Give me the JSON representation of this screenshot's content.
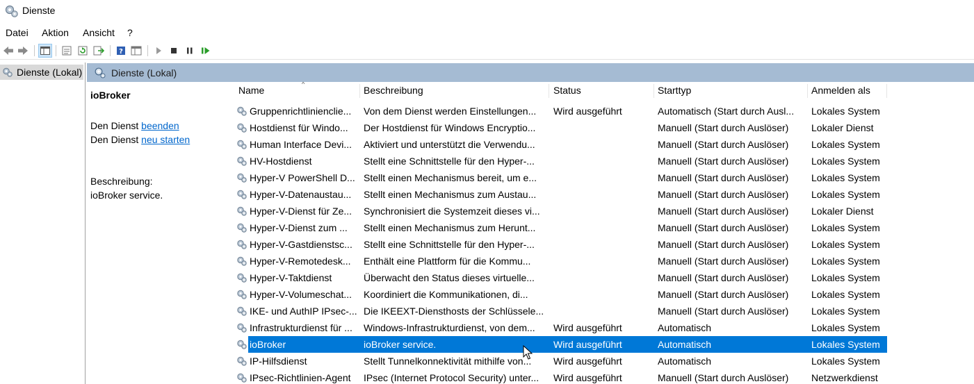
{
  "window": {
    "title": "Dienste",
    "icon": "gear-icon"
  },
  "menu": {
    "items": [
      "Datei",
      "Aktion",
      "Ansicht",
      "?"
    ]
  },
  "toolbar": {
    "buttons": [
      {
        "name": "back-arrow-icon"
      },
      {
        "name": "forward-arrow-icon"
      },
      {
        "name": "show-hide-tree-icon"
      },
      {
        "name": "properties-icon"
      },
      {
        "name": "refresh-icon"
      },
      {
        "name": "export-list-icon"
      },
      {
        "name": "help-icon"
      },
      {
        "name": "console-view-icon"
      },
      {
        "name": "start-service-icon"
      },
      {
        "name": "stop-service-icon"
      },
      {
        "name": "pause-service-icon"
      },
      {
        "name": "restart-service-icon"
      }
    ]
  },
  "tree": {
    "item_label": "Dienste (Lokal)"
  },
  "panel": {
    "header": "Dienste (Lokal)"
  },
  "detail": {
    "service_name": "ioBroker",
    "stop_prefix": "Den Dienst ",
    "stop_link": "beenden",
    "restart_prefix": "Den Dienst ",
    "restart_link": "neu starten",
    "description_label": "Beschreibung:",
    "description_text": "ioBroker service."
  },
  "table": {
    "columns": [
      "Name",
      "Beschreibung",
      "Status",
      "Starttyp",
      "Anmelden als"
    ],
    "sorted_column": "Name",
    "selected_row": 14,
    "rows": [
      {
        "name": "Gruppenrichtlinienclie...",
        "description": "Von dem Dienst werden Einstellungen...",
        "status": "Wird ausgeführt",
        "starttype": "Automatisch (Start durch Ausl...",
        "logon": "Lokales System"
      },
      {
        "name": "Hostdienst für Windo...",
        "description": "Der Hostdienst für Windows Encryptio...",
        "status": "",
        "starttype": "Manuell (Start durch Auslöser)",
        "logon": "Lokaler Dienst"
      },
      {
        "name": "Human Interface Devi...",
        "description": "Aktiviert und unterstützt die Verwendu...",
        "status": "",
        "starttype": "Manuell (Start durch Auslöser)",
        "logon": "Lokales System"
      },
      {
        "name": "HV-Hostdienst",
        "description": "Stellt eine Schnittstelle für den Hyper-...",
        "status": "",
        "starttype": "Manuell (Start durch Auslöser)",
        "logon": "Lokales System"
      },
      {
        "name": "Hyper-V PowerShell D...",
        "description": "Stellt einen Mechanismus bereit, um e...",
        "status": "",
        "starttype": "Manuell (Start durch Auslöser)",
        "logon": "Lokales System"
      },
      {
        "name": "Hyper-V-Datenaustau...",
        "description": "Stellt einen Mechanismus zum Austau...",
        "status": "",
        "starttype": "Manuell (Start durch Auslöser)",
        "logon": "Lokales System"
      },
      {
        "name": "Hyper-V-Dienst für Ze...",
        "description": "Synchronisiert die Systemzeit dieses vi...",
        "status": "",
        "starttype": "Manuell (Start durch Auslöser)",
        "logon": "Lokaler Dienst"
      },
      {
        "name": "Hyper-V-Dienst zum ...",
        "description": "Stellt einen Mechanismus zum Herunt...",
        "status": "",
        "starttype": "Manuell (Start durch Auslöser)",
        "logon": "Lokales System"
      },
      {
        "name": "Hyper-V-Gastdienstsc...",
        "description": "Stellt eine Schnittstelle für den Hyper-...",
        "status": "",
        "starttype": "Manuell (Start durch Auslöser)",
        "logon": "Lokales System"
      },
      {
        "name": "Hyper-V-Remotedesk...",
        "description": "Enthält eine Plattform für die Kommu...",
        "status": "",
        "starttype": "Manuell (Start durch Auslöser)",
        "logon": "Lokales System"
      },
      {
        "name": "Hyper-V-Taktdienst",
        "description": "Überwacht den Status dieses virtuelle...",
        "status": "",
        "starttype": "Manuell (Start durch Auslöser)",
        "logon": "Lokales System"
      },
      {
        "name": "Hyper-V-Volumeschat...",
        "description": "Koordiniert die Kommunikationen, di...",
        "status": "",
        "starttype": "Manuell (Start durch Auslöser)",
        "logon": "Lokales System"
      },
      {
        "name": "IKE- und AuthIP IPsec-...",
        "description": "Die IKEEXT-Diensthosts der Schlüssele...",
        "status": "",
        "starttype": "Manuell (Start durch Auslöser)",
        "logon": "Lokales System"
      },
      {
        "name": "Infrastrukturdienst für ...",
        "description": "Windows-Infrastrukturdienst, von dem...",
        "status": "Wird ausgeführt",
        "starttype": "Automatisch",
        "logon": "Lokales System"
      },
      {
        "name": "ioBroker",
        "description": "ioBroker service.",
        "status": "Wird ausgeführt",
        "starttype": "Automatisch",
        "logon": "Lokales System"
      },
      {
        "name": "IP-Hilfsdienst",
        "description": "Stellt Tunnelkonnektivität mithilfe von...",
        "status": "Wird ausgeführt",
        "starttype": "Automatisch",
        "logon": "Lokales System"
      },
      {
        "name": "IPsec-Richtlinien-Agent",
        "description": "IPsec (Internet Protocol Security) unter...",
        "status": "Wird ausgeführt",
        "starttype": "Manuell (Start durch Auslöser)",
        "logon": "Netzwerkdienst"
      }
    ]
  }
}
